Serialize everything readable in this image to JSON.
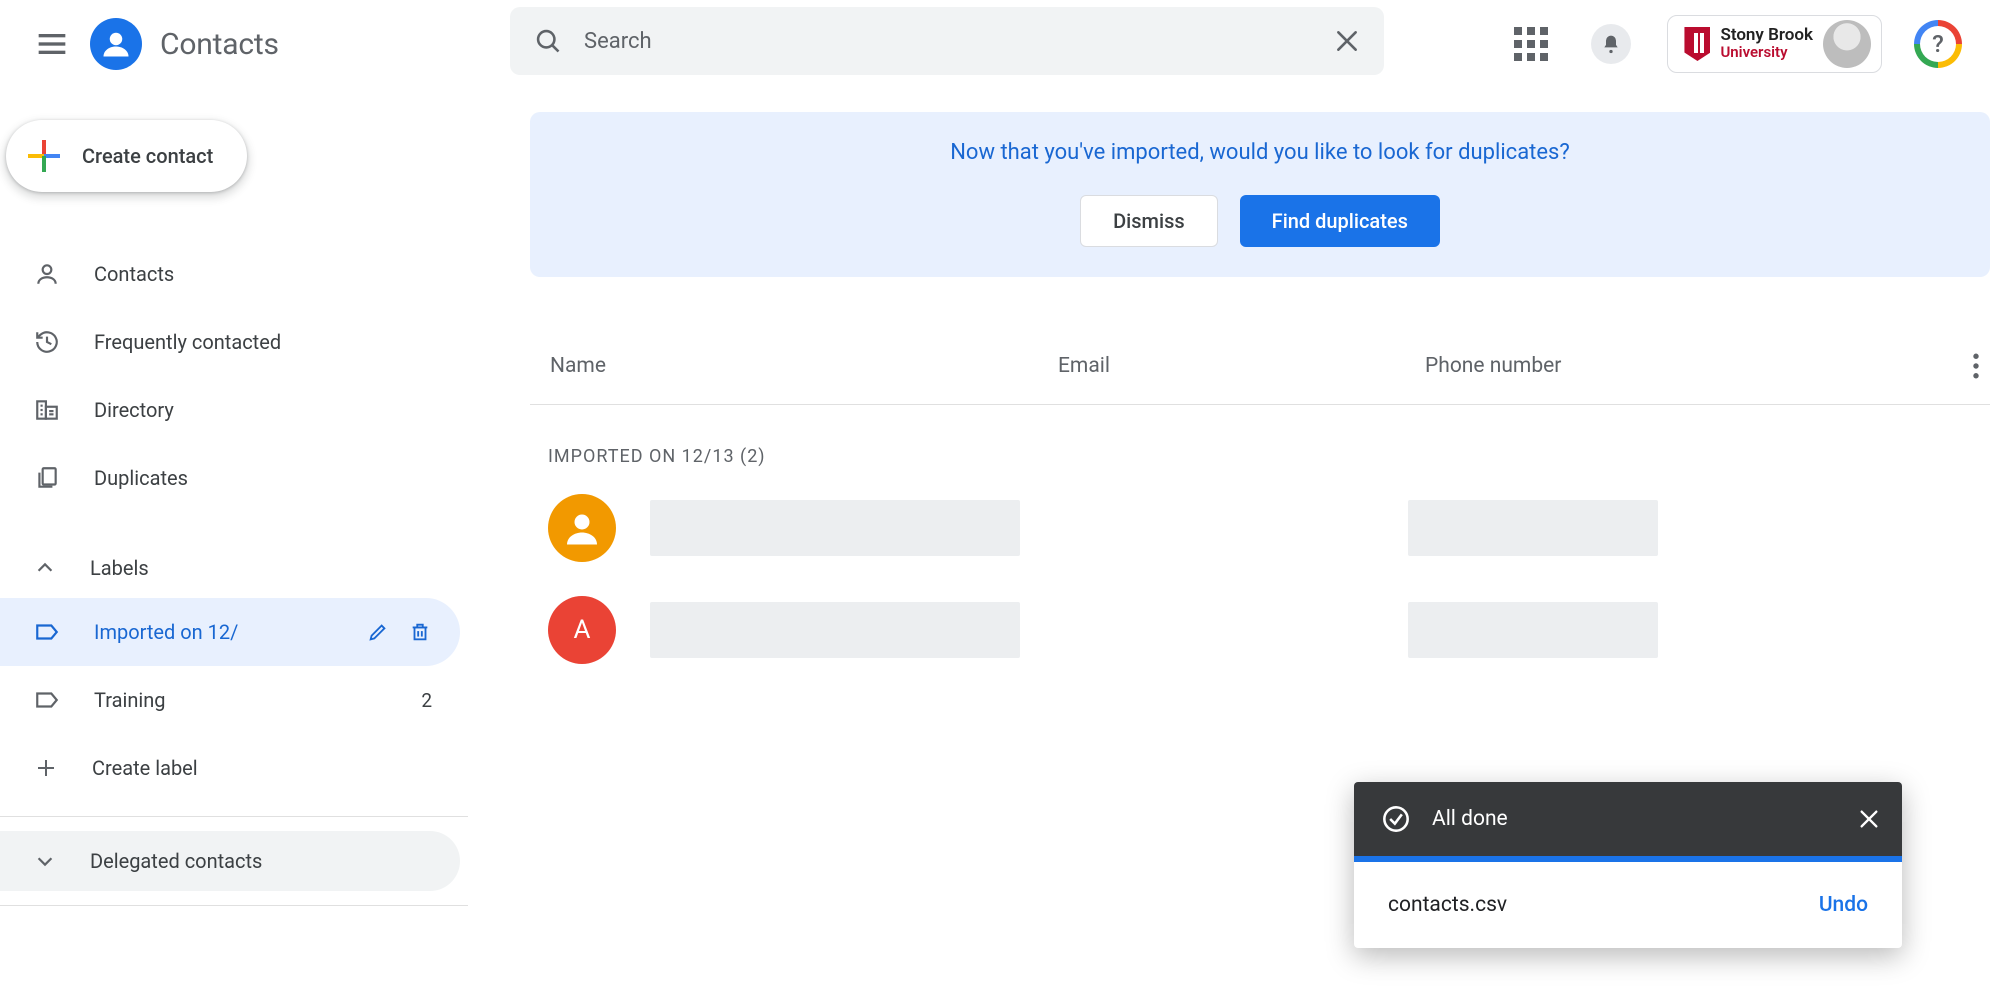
{
  "header": {
    "app_title": "Contacts",
    "search_placeholder": "Search",
    "org": {
      "line1": "Stony Brook",
      "line2": "University"
    },
    "help_badge_glyph": "?"
  },
  "sidebar": {
    "create_label": "Create contact",
    "items": [
      {
        "icon": "person",
        "label": "Contacts"
      },
      {
        "icon": "history",
        "label": "Frequently contacted"
      },
      {
        "icon": "domain",
        "label": "Directory"
      },
      {
        "icon": "copy",
        "label": "Duplicates"
      }
    ],
    "labels_header": "Labels",
    "labels": [
      {
        "label": "Imported on 12/",
        "selected": true,
        "edit": true,
        "delete": true
      },
      {
        "label": "Training",
        "count": "2",
        "selected": false
      }
    ],
    "create_label_label": "Create label",
    "delegated_header": "Delegated contacts"
  },
  "banner": {
    "message": "Now that you've imported, would you like to look for duplicates?",
    "dismiss": "Dismiss",
    "find_dup": "Find duplicates"
  },
  "columns": {
    "name": "Name",
    "email": "Email",
    "phone": "Phone number"
  },
  "group_header": "Imported on 12/13 (2)",
  "rows": [
    {
      "avatar_kind": "person",
      "avatar_color": "orange"
    },
    {
      "avatar_kind": "letter",
      "avatar_letter": "A",
      "avatar_color": "red"
    }
  ],
  "toast": {
    "title": "All done",
    "file": "contacts.csv",
    "undo": "Undo"
  }
}
